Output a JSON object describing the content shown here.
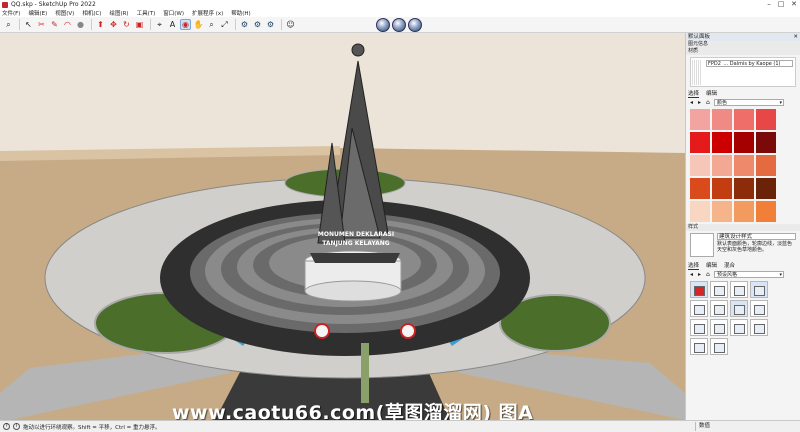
{
  "window": {
    "title": "QQ.skp - SketchUp Pro 2022",
    "minimize": "–",
    "maximize": "□",
    "close": "✕"
  },
  "menu": [
    "文件(F)",
    "编辑(E)",
    "视图(V)",
    "相机(C)",
    "绘图(R)",
    "工具(T)",
    "窗口(W)",
    "扩展程序 (x)",
    "帮助(H)"
  ],
  "toolbar": [
    {
      "icon": "search-icon",
      "glyph": "⌕"
    },
    {
      "icon": "select-arrow-icon",
      "glyph": "↖"
    },
    {
      "icon": "eraser-icon",
      "glyph": "✂"
    },
    {
      "icon": "pencil-line-icon",
      "glyph": "✎"
    },
    {
      "icon": "arc-icon",
      "glyph": "◠"
    },
    {
      "icon": "paint-bucket-icon",
      "glyph": "●"
    },
    {
      "icon": "push-pull-icon",
      "glyph": "⬆"
    },
    {
      "icon": "move-icon",
      "glyph": "✥"
    },
    {
      "icon": "rotate-icon",
      "glyph": "↻"
    },
    {
      "icon": "scale-icon",
      "glyph": "▣"
    },
    {
      "icon": "tape-measure-icon",
      "glyph": "⌖"
    },
    {
      "icon": "text-icon",
      "glyph": "A"
    },
    {
      "icon": "orbit-icon",
      "glyph": "◉",
      "selected": true
    },
    {
      "icon": "pan-icon",
      "glyph": "✋"
    },
    {
      "icon": "zoom-icon",
      "glyph": "⌕"
    },
    {
      "icon": "zoom-extents-icon",
      "glyph": "⤢"
    },
    {
      "icon": "warehouse-icon",
      "glyph": "⚙"
    },
    {
      "icon": "extension-warehouse-icon",
      "glyph": "⚙"
    },
    {
      "icon": "layout-icon",
      "glyph": "⚙"
    },
    {
      "icon": "user-account-icon",
      "glyph": "☺"
    }
  ],
  "viewport": {
    "sky_color": "#ece4d8",
    "ground_color": "#c7ab86",
    "monument_text_line1": "MONUMEN DEKLARASI",
    "monument_text_line2": "TANJUNG KELAYANG",
    "watermark": "www.caotu66.com(草图溜溜网) 图A"
  },
  "tray": {
    "title": "默认面板",
    "entity_info": "图元信息",
    "materials_section": "材质",
    "material_name": "FPD2_... Dalmis by Kaope (1)",
    "tab_select": "选择",
    "tab_edit": "编辑",
    "collection": "颜色",
    "swatches": [
      "#f2a5a0",
      "#ef8a84",
      "#ef6e6a",
      "#e84747",
      "#e51a1a",
      "#cc0000",
      "#a50000",
      "#7a0a0a",
      "#f6c7b8",
      "#f3a893",
      "#ee8a6b",
      "#e46b40",
      "#d94a1c",
      "#c23e10",
      "#8d2c0a",
      "#6a2208",
      "#f8d6bf",
      "#f6b48a",
      "#f39a5f",
      "#f27f37"
    ],
    "styles_section": "样式",
    "style_name": "建筑设计样式",
    "style_desc": "默认表面颜色，轮廓边线，淡蓝色天空和灰色草地颜色。",
    "style_tab_mix": "混合",
    "style_collection": "预设风格"
  },
  "status": {
    "hint": "拖动以进行环绕观察。Shift = 平移，Ctrl = 重力悬浮。",
    "measure_label": "数值"
  }
}
